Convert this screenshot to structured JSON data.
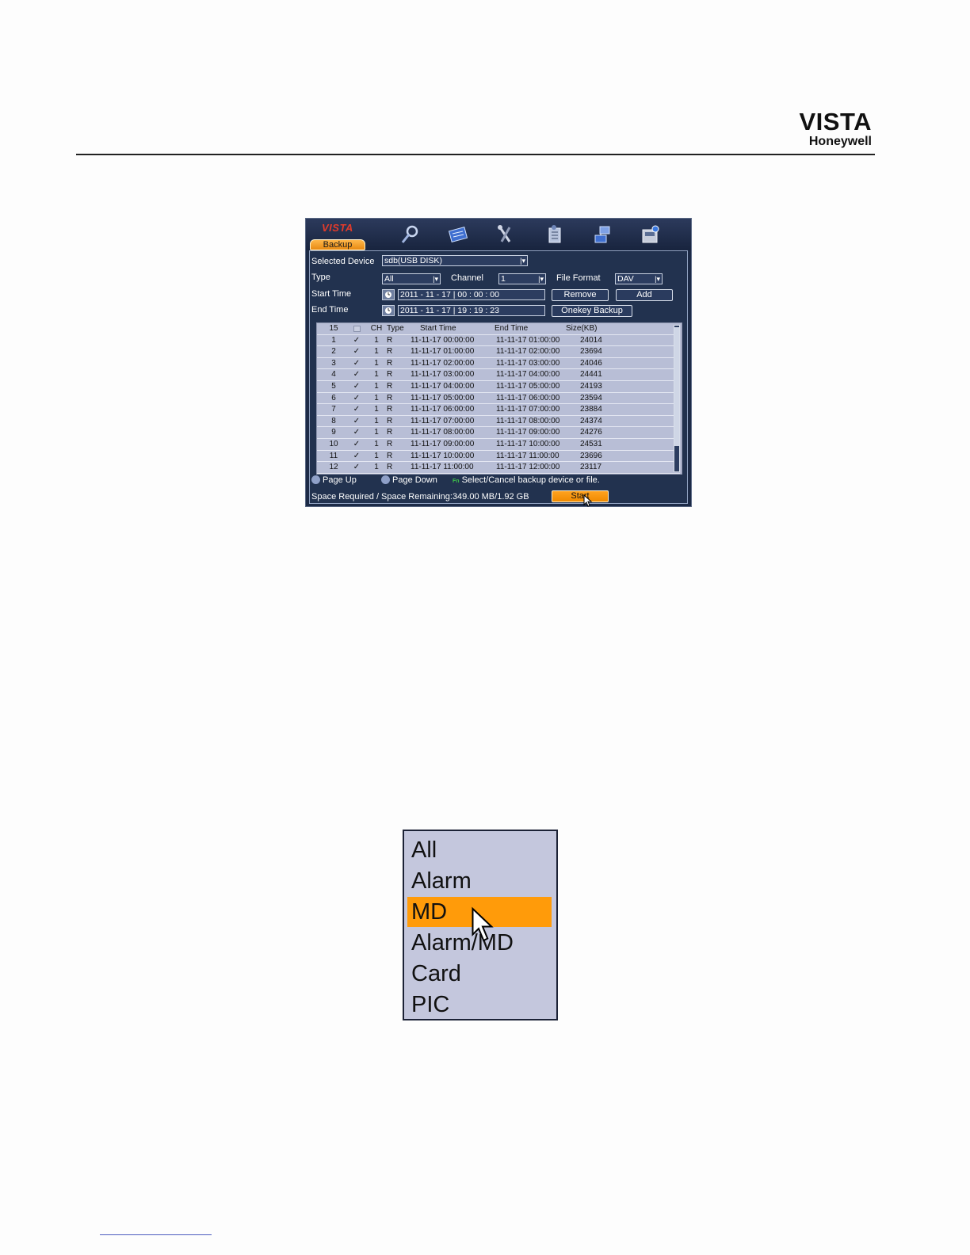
{
  "document": {
    "brand_line1": "VISTA",
    "brand_line2": "Honeywell"
  },
  "dvr": {
    "logo": "VISTA",
    "tab": "Backup",
    "toolbar_icons": [
      "search-icon",
      "record-icon",
      "tools-icon",
      "settings-icon",
      "network-icon",
      "backup-icon"
    ],
    "labels": {
      "selected_device": "Selected Device",
      "type": "Type",
      "channel": "Channel",
      "file_format": "File Format",
      "start_time": "Start Time",
      "end_time": "End Time"
    },
    "values": {
      "selected_device": "sdb(USB DISK)",
      "type": "All",
      "channel": "1",
      "file_format": "DAV",
      "start_time": "2011  -  11  -  17  | 00  :  00  :  00",
      "end_time": "2011  -  11  -  17  | 19  :  19  :  23"
    },
    "buttons": {
      "remove": "Remove",
      "add": "Add",
      "onekey_backup": "Onekey Backup",
      "start": "Start"
    },
    "table": {
      "headers": {
        "count": "15",
        "ch": "CH",
        "type": "Type",
        "start": "Start Time",
        "end": "End Time",
        "size": "Size(KB)"
      },
      "rows": [
        {
          "no": "1",
          "chk": "✓",
          "ch": "1",
          "type": "R",
          "start": "11-11-17 00:00:00",
          "end": "11-11-17 01:00:00",
          "size": "24014"
        },
        {
          "no": "2",
          "chk": "✓",
          "ch": "1",
          "type": "R",
          "start": "11-11-17 01:00:00",
          "end": "11-11-17 02:00:00",
          "size": "23694"
        },
        {
          "no": "3",
          "chk": "✓",
          "ch": "1",
          "type": "R",
          "start": "11-11-17 02:00:00",
          "end": "11-11-17 03:00:00",
          "size": "24046"
        },
        {
          "no": "4",
          "chk": "✓",
          "ch": "1",
          "type": "R",
          "start": "11-11-17 03:00:00",
          "end": "11-11-17 04:00:00",
          "size": "24441"
        },
        {
          "no": "5",
          "chk": "✓",
          "ch": "1",
          "type": "R",
          "start": "11-11-17 04:00:00",
          "end": "11-11-17 05:00:00",
          "size": "24193"
        },
        {
          "no": "6",
          "chk": "✓",
          "ch": "1",
          "type": "R",
          "start": "11-11-17 05:00:00",
          "end": "11-11-17 06:00:00",
          "size": "23594"
        },
        {
          "no": "7",
          "chk": "✓",
          "ch": "1",
          "type": "R",
          "start": "11-11-17 06:00:00",
          "end": "11-11-17 07:00:00",
          "size": "23884"
        },
        {
          "no": "8",
          "chk": "✓",
          "ch": "1",
          "type": "R",
          "start": "11-11-17 07:00:00",
          "end": "11-11-17 08:00:00",
          "size": "24374"
        },
        {
          "no": "9",
          "chk": "✓",
          "ch": "1",
          "type": "R",
          "start": "11-11-17 08:00:00",
          "end": "11-11-17 09:00:00",
          "size": "24276"
        },
        {
          "no": "10",
          "chk": "✓",
          "ch": "1",
          "type": "R",
          "start": "11-11-17 09:00:00",
          "end": "11-11-17 10:00:00",
          "size": "24531"
        },
        {
          "no": "11",
          "chk": "✓",
          "ch": "1",
          "type": "R",
          "start": "11-11-17 10:00:00",
          "end": "11-11-17 11:00:00",
          "size": "23696"
        },
        {
          "no": "12",
          "chk": "✓",
          "ch": "1",
          "type": "R",
          "start": "11-11-17 11:00:00",
          "end": "11-11-17 12:00:00",
          "size": "23117"
        }
      ]
    },
    "nav": {
      "page_up": "Page Up",
      "page_down": "Page Down",
      "fn_key": "Fn",
      "hint": "Select/Cancel backup device or file."
    },
    "space": "Space Required / Space Remaining:349.00 MB/1.92 GB"
  },
  "type_dropdown": {
    "options": [
      "All",
      "Alarm",
      "MD",
      "Alarm/MD",
      "Card",
      "PIC"
    ],
    "selected": "MD"
  }
}
